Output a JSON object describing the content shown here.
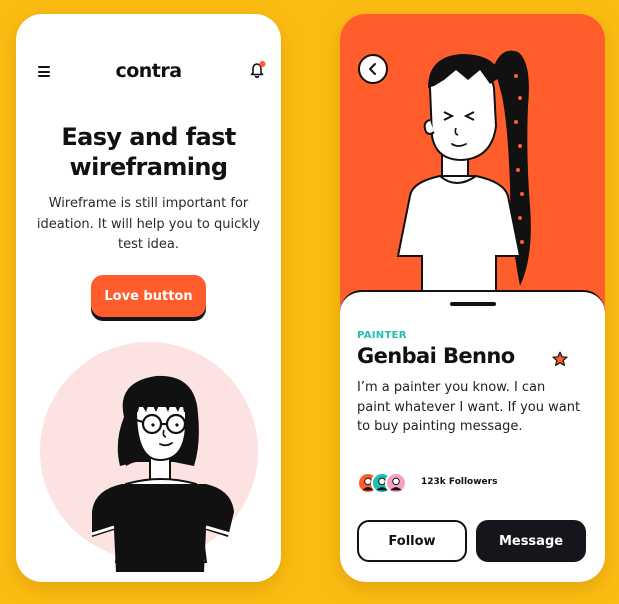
{
  "left_screen": {
    "logo": "contra",
    "menu_icon": "hamburger-menu-icon",
    "notification_icon": "bell-icon",
    "headline": "Easy and fast wireframing",
    "subtext": "Wireframe is still important for ideation. It will help you to quickly test idea.",
    "button_label": "Love button",
    "illustration": "girl-with-glasses"
  },
  "right_screen": {
    "back_icon": "chevron-left-icon",
    "illustration": "person-with-braided-ponytail",
    "profile": {
      "role": "PAINTER",
      "name": "Genbai Benno",
      "badge_icon": "star-icon",
      "bio": "I’m a painter you know. I can paint whatever I want. If you want to buy painting message.",
      "followers": "123k Followers",
      "follow_label": "Follow",
      "message_label": "Message"
    }
  },
  "colors": {
    "background": "#FBBC12",
    "accent": "#FF5E2C",
    "teal": "#1FC0B4",
    "dark": "#14161C",
    "pink": "#FCE2E0"
  }
}
